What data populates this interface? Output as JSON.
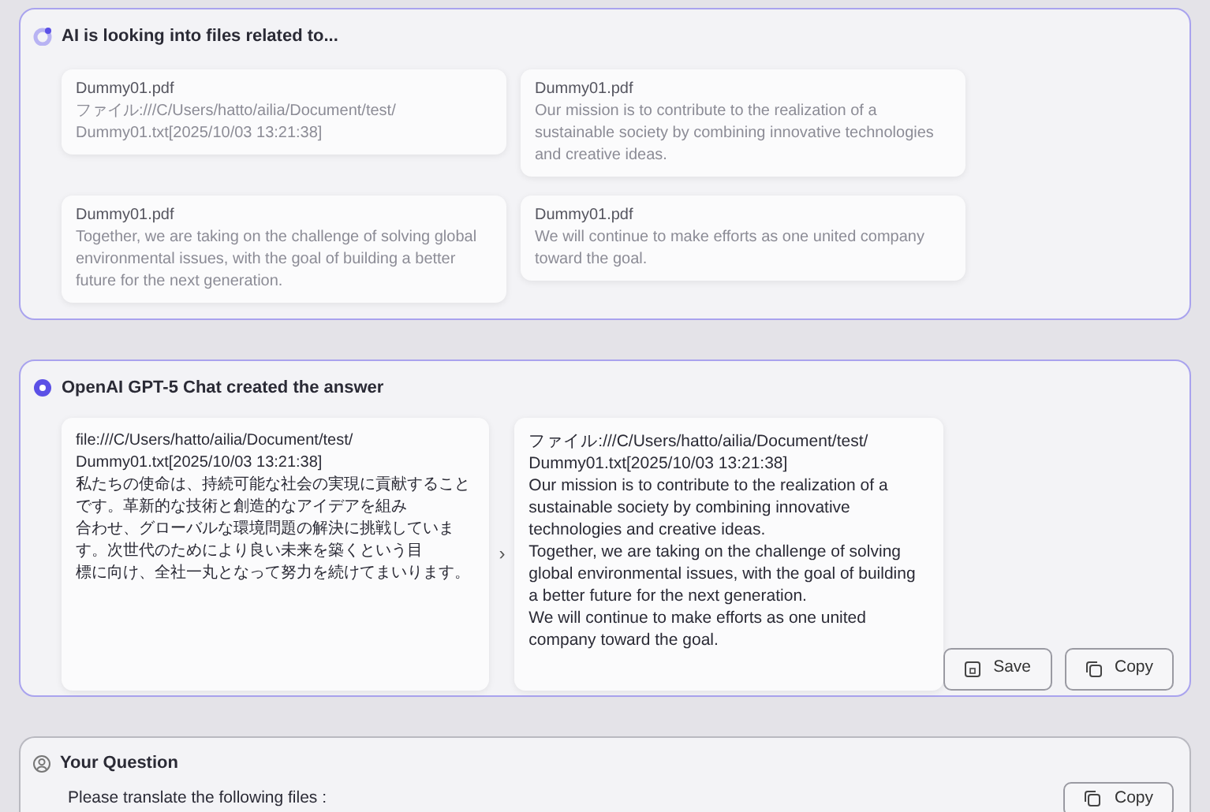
{
  "search_panel": {
    "title": "AI is looking into files related to...",
    "results": [
      {
        "file": "Dummy01.pdf",
        "snippet": "ファイル:///C/Users/hatto/ailia/Document/test/\nDummy01.txt[2025/10/03 13:21:38]"
      },
      {
        "file": "Dummy01.pdf",
        "snippet": "Our mission is to contribute to the realization of a sustainable society by combining innovative technologies and creative ideas."
      },
      {
        "file": "Dummy01.pdf",
        "snippet": "Together, we are taking on the challenge of solving global environmental issues, with the goal of building a better future for the next generation."
      },
      {
        "file": "Dummy01.pdf",
        "snippet": "We will continue to make efforts as one united company toward the goal."
      }
    ]
  },
  "answer_panel": {
    "title": "OpenAI GPT-5 Chat created the answer",
    "source_lines": [
      "file:///C/Users/hatto/ailia/Document/test/",
      "Dummy01.txt[2025/10/03 13:21:38]",
      "私たちの使命は、持続可能な社会の実現に貢献すること",
      "です。革新的な技術と創造的なアイデアを組み",
      "合わせ、グローバルな環境問題の解決に挑戦していま",
      "す。次世代のためにより良い未来を築くという目",
      "標に向け、全社一丸となって努力を続けてまいります。"
    ],
    "arrow": "›",
    "translated_text": "ファイル:///C/Users/hatto/ailia/Document/test/\nDummy01.txt[2025/10/03 13:21:38]\nOur mission is to contribute to the realization of a sustainable society by combining innovative technologies and creative ideas.\nTogether, we are taking on the challenge of solving global environmental issues, with the goal of building a better future for the next generation.\nWe will continue to make efforts as one united company toward the goal.",
    "buttons": [
      "Save",
      "Copy"
    ]
  },
  "question_panel": {
    "title": "Your Question",
    "text": "Please translate the following files :",
    "copy_button": "Copy"
  }
}
